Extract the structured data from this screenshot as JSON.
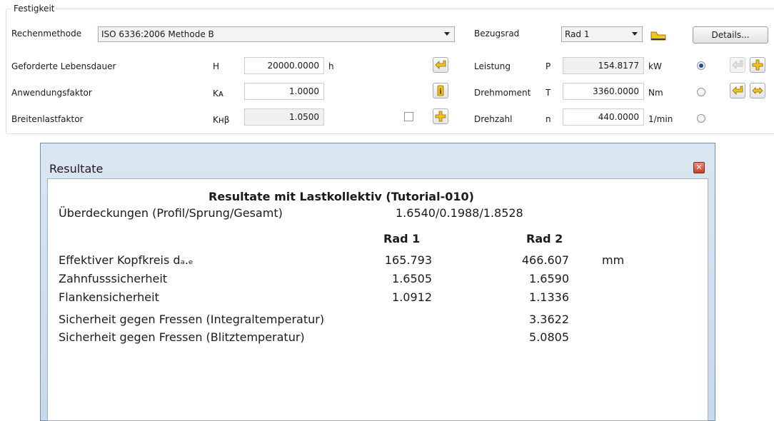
{
  "group": {
    "title": "Festigkeit"
  },
  "method": {
    "label": "Rechenmethode",
    "value": "ISO 6336:2006 Methode B"
  },
  "bezugsrad": {
    "label": "Bezugsrad",
    "value": "Rad 1",
    "details_label": "Details..."
  },
  "rows": {
    "lebensdauer": {
      "label": "Geforderte Lebensdauer",
      "symbol": "H",
      "value": "20000.0000",
      "unit": "h"
    },
    "anwendung": {
      "label": "Anwendungsfaktor",
      "symbol": "Kᴀ",
      "value": "1.0000"
    },
    "breite": {
      "label": "Breitenlastfaktor",
      "symbol": "Kʜβ",
      "value": "1.0500"
    }
  },
  "power": {
    "label": "Leistung",
    "symbol": "P",
    "value": "154.8177",
    "unit": "kW"
  },
  "torque": {
    "label": "Drehmoment",
    "symbol": "T",
    "value": "3360.0000",
    "unit": "Nm"
  },
  "speed": {
    "label": "Drehzahl",
    "symbol": "n",
    "value": "440.0000",
    "unit": "1/min"
  },
  "results": {
    "window_title": "Resultate",
    "heading": "Resultate mit Lastkollektiv (Tutorial-010)",
    "overlap_label": "Überdeckungen (Profil/Sprung/Gesamt)",
    "overlap_value": "1.6540/0.1988/1.8528",
    "col1": "Rad 1",
    "col2": "Rad 2",
    "rows": [
      {
        "label": "Effektiver Kopfkreis dₐ.ₑ",
        "v1": "165.793",
        "v2": "466.607",
        "unit": "mm"
      },
      {
        "label": "Zahnfusssicherheit",
        "v1": "1.6505",
        "v2": "1.6590"
      },
      {
        "label": "Flankensicherheit",
        "v1": "1.0912",
        "v2": "1.1336"
      },
      {
        "label": "Sicherheit gegen Fressen (Integraltemperatur)",
        "v2": "3.3622"
      },
      {
        "label": "Sicherheit gegen Fressen (Blitztemperatur)",
        "v2": "5.0805"
      }
    ]
  },
  "colors": {
    "accent": "#1f4f8a",
    "icon_yellow": "#f3c320",
    "window_border": "#6f8fb3"
  },
  "icons": [
    "import-arrow-icon",
    "info-icon",
    "plus-icon",
    "folder-icon",
    "close-icon"
  ]
}
